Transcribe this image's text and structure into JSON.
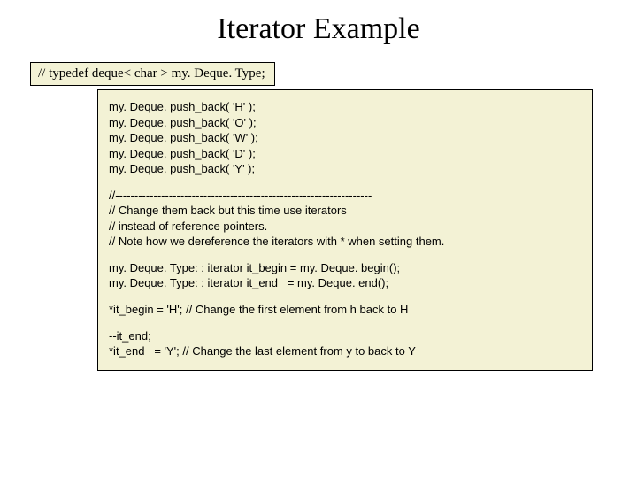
{
  "title": "Iterator Example",
  "typedef": "// typedef deque< char > my. Deque. Type;",
  "code": {
    "push": "my. Deque. push_back( 'H' );\nmy. Deque. push_back( 'O' );\nmy. Deque. push_back( 'W' );\nmy. Deque. push_back( 'D' );\nmy. Deque. push_back( 'Y' );",
    "comments": "//-------------------------------------------------------------------\n// Change them back but this time use iterators\n// instead of reference pointers.\n// Note how we dereference the iterators with * when setting them.",
    "iters": "my. Deque. Type: : iterator it_begin = my. Deque. begin();\nmy. Deque. Type: : iterator it_end   = my. Deque. end();",
    "first": "*it_begin = 'H'; // Change the first element from h back to H",
    "last": "--it_end;\n*it_end   = 'Y'; // Change the last element from y to back to Y"
  }
}
